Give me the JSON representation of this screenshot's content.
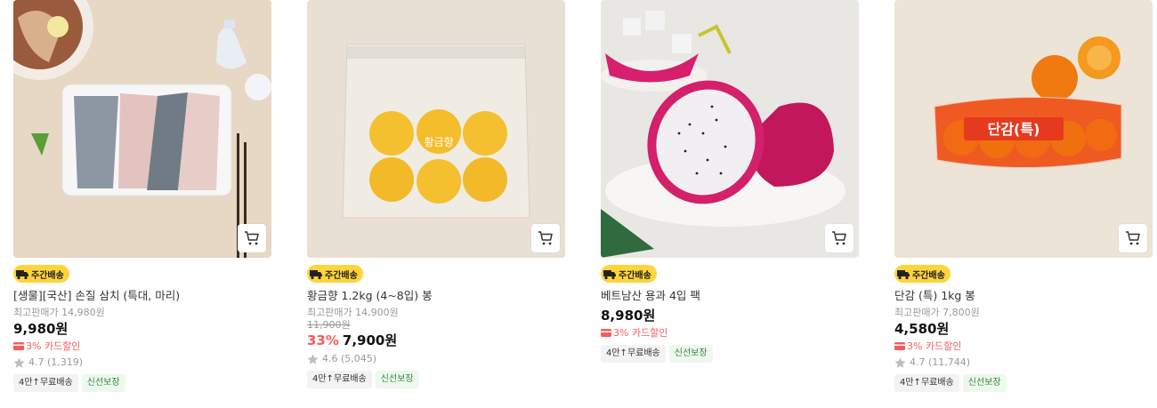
{
  "cart_label": "장바구니 담기",
  "products": [
    {
      "badge": "주간배송",
      "name": "[생물][국산] 손질 삼치 (특대, 마리)",
      "reference_price": "최고판매가 14,980원",
      "original_price": "",
      "discount": "",
      "price": "9,980원",
      "card_discount": "3% 카드할인",
      "rating": "4.7 (1,319)",
      "tags": [
        "4만↑무료배송",
        "신선보장"
      ]
    },
    {
      "badge": "주간배송",
      "name": "황금향 1.2kg (4~8입) 봉",
      "reference_price": "최고판매가 14,900원",
      "original_price": "11,900원",
      "discount": "33%",
      "price": "7,900원",
      "card_discount": "",
      "rating": "4.6 (5,045)",
      "tags": [
        "4만↑무료배송",
        "신선보장"
      ]
    },
    {
      "badge": "주간배송",
      "name": "베트남산 용과 4입 팩",
      "reference_price": "",
      "original_price": "",
      "discount": "",
      "price": "8,980원",
      "card_discount": "3% 카드할인",
      "rating": "",
      "tags": [
        "4만↑무료배송",
        "신선보장"
      ]
    },
    {
      "badge": "주간배송",
      "name": "단감 (특) 1kg 봉",
      "reference_price": "최고판매가 7,800원",
      "original_price": "",
      "discount": "",
      "price": "4,580원",
      "card_discount": "3% 카드할인",
      "rating": "4.7 (11,744)",
      "tags": [
        "4만↑무료배송",
        "신선보장"
      ]
    }
  ],
  "image_text": {
    "citrus_bag": "황금향",
    "persimmon_bag": "단감(특)"
  },
  "colors": {
    "badge": "#ffd43b",
    "discount": "#fa5a5a",
    "fresh_tag": "#2e8b3a"
  }
}
